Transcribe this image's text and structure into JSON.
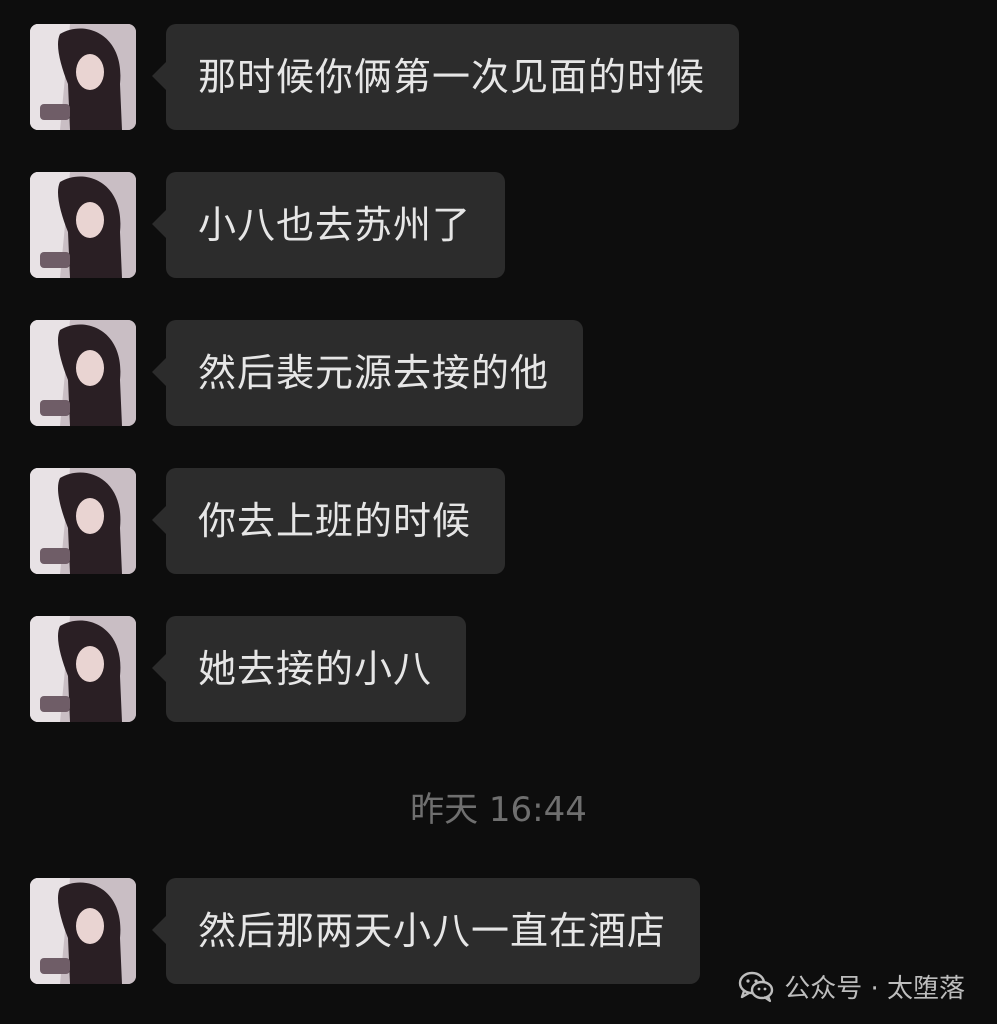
{
  "messages": [
    {
      "text": "那时候你俩第一次见面的时候"
    },
    {
      "text": "小八也去苏州了"
    },
    {
      "text": "然后裴元源去接的他"
    },
    {
      "text": "你去上班的时候"
    },
    {
      "text": "她去接的小八"
    },
    {
      "text": "然后那两天小八一直在酒店"
    }
  ],
  "timestamp": "昨天 16:44",
  "watermark": {
    "icon": "wechat-icon",
    "text": "公众号 · 太堕落"
  },
  "colors": {
    "background": "#0d0d0d",
    "bubble": "#2c2c2c",
    "bubble_text": "#e6e6e6",
    "timestamp_text": "#6f6f6f"
  }
}
